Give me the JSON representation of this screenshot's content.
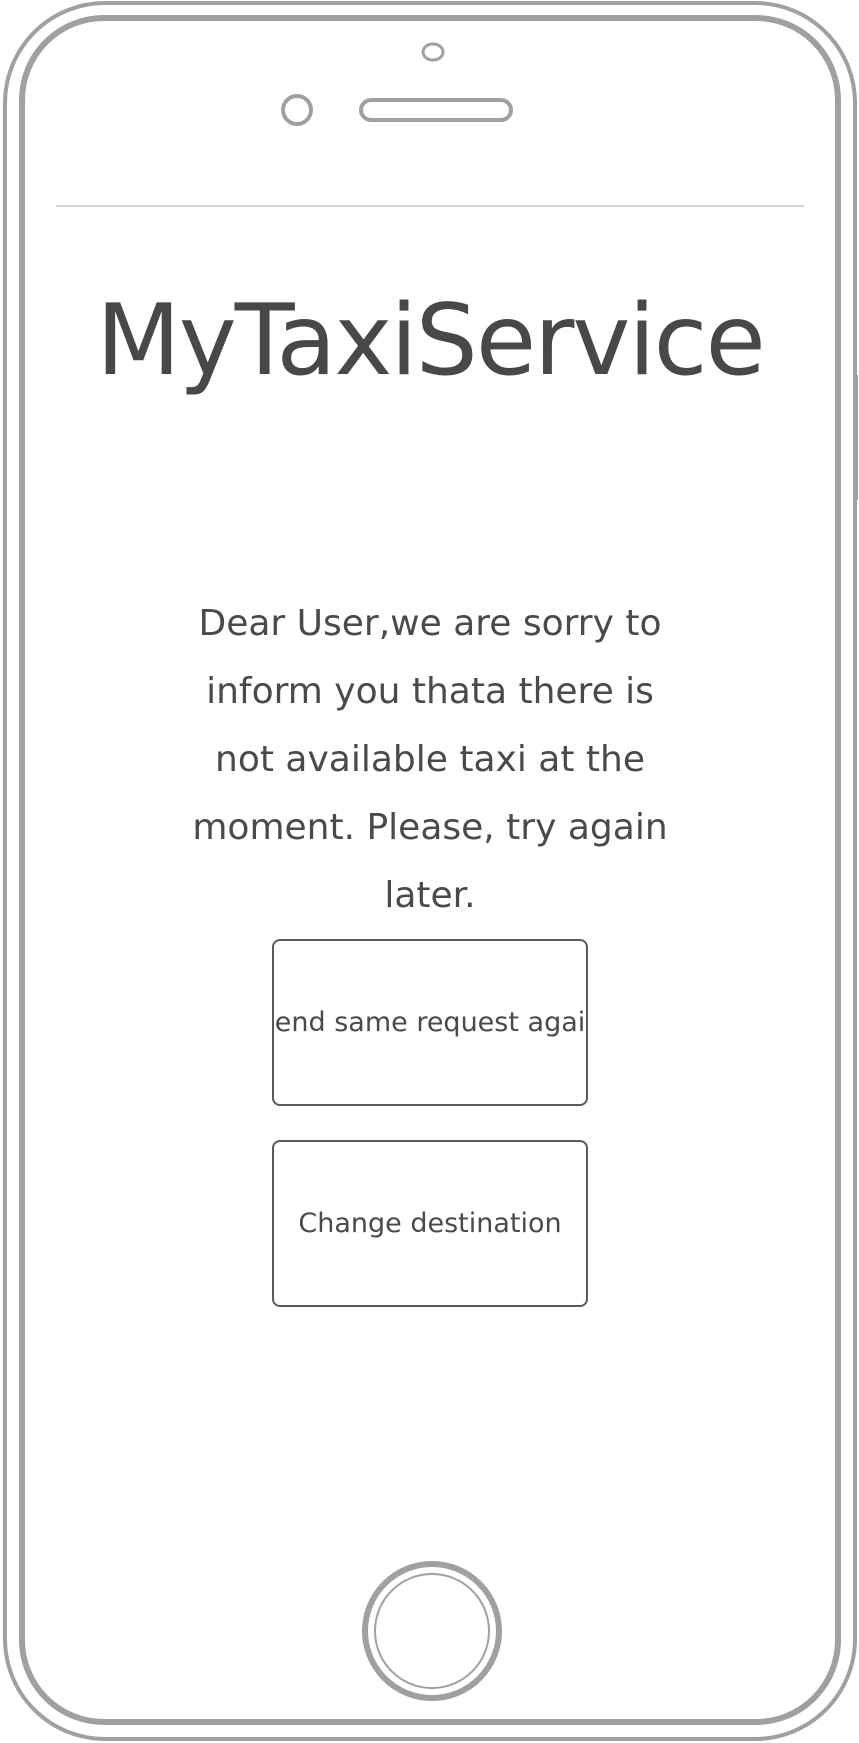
{
  "app": {
    "title": "MyTaxiService"
  },
  "main": {
    "message": "Dear User,we are sorry to inform you thata there is not available taxi at the moment. Please, try again later.",
    "buttons": {
      "resend_label": "Send same request again",
      "change_destination_label": "Change destination"
    }
  },
  "device": {
    "frame_color": "#a0a0a0",
    "icons": [
      "front-camera-icon",
      "sensor-icon",
      "speaker-icon",
      "home-button-icon"
    ]
  }
}
